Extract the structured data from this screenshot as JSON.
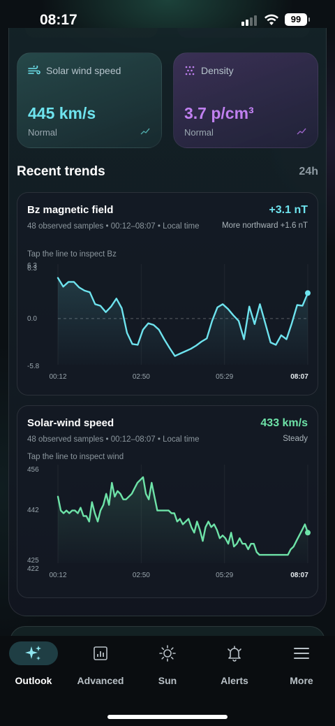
{
  "status_bar": {
    "time": "08:17",
    "battery": "99"
  },
  "metrics": {
    "wind": {
      "label": "Solar wind speed",
      "value": "445 km/s",
      "status": "Normal",
      "icon": "wind-icon",
      "color": "#6ee3ee"
    },
    "density": {
      "label": "Density",
      "value": "3.7 p/cm³",
      "status": "Normal",
      "icon": "particles-icon",
      "color": "#c080f0"
    }
  },
  "trends": {
    "title": "Recent trends",
    "range": "24h"
  },
  "bz_card": {
    "title": "Bz magnetic field",
    "subtitle": "48 observed samples • 00:12–08:07 • Local time",
    "value": "+3.1 nT",
    "note": "More northward +1.6 nT",
    "hint": "Tap the line to inspect Bz",
    "value_color": "#6ee3ee"
  },
  "wind_card": {
    "title": "Solar-wind speed",
    "subtitle": "48 observed samples • 00:12–08:07 • Local time",
    "value": "433 km/s",
    "note": "Steady",
    "hint": "Tap the line to inspect wind",
    "value_color": "#6ee3a8"
  },
  "chart_data": [
    {
      "type": "line",
      "title": "Bz magnetic field",
      "x_ticks": [
        "00:12",
        "02:50",
        "05:29",
        "08:07"
      ],
      "y_ticks": [
        "6.3",
        "6.3",
        "0.0",
        "-5.8"
      ],
      "ylim": [
        -5.8,
        6.3
      ],
      "zero_line": true,
      "color": "#6ee3ee",
      "series": [
        {
          "values": [
            5.1,
            4.0,
            4.6,
            4.6,
            3.9,
            3.5,
            3.3,
            1.8,
            1.6,
            0.8,
            1.5,
            2.5,
            1.3,
            -1.8,
            -3.2,
            -3.3,
            -1.4,
            -0.6,
            -0.8,
            -1.4,
            -2.6,
            -3.7,
            -4.7,
            -4.4,
            -4.1,
            -3.8,
            -3.4,
            -2.9,
            -2.5,
            -0.3,
            1.4,
            1.8,
            1.2,
            0.4,
            -0.3,
            -2.6,
            1.5,
            -0.7,
            1.8,
            -0.6,
            -3.0,
            -3.3,
            -2.1,
            -2.6,
            -0.6,
            1.7,
            1.6,
            3.2
          ]
        }
      ]
    },
    {
      "type": "line",
      "title": "Solar-wind speed",
      "x_ticks": [
        "00:12",
        "02:50",
        "05:29",
        "08:07"
      ],
      "y_ticks": [
        "456",
        "442",
        "425",
        "422"
      ],
      "ylim": [
        422,
        456
      ],
      "color": "#6ee3a8",
      "series": [
        {
          "values": [
            446,
            441,
            440,
            441,
            440,
            441,
            441,
            440,
            442,
            439,
            439,
            437,
            444,
            440,
            437,
            441,
            443,
            447,
            443,
            451,
            446,
            448,
            447,
            445,
            445,
            446,
            447,
            449,
            451,
            452,
            453,
            447,
            445,
            451,
            446,
            441,
            441,
            441,
            441,
            441,
            440,
            440,
            437,
            438,
            436,
            437,
            438,
            435,
            433,
            437,
            434,
            430,
            435,
            437,
            435,
            436,
            434,
            431,
            432,
            431,
            429,
            433,
            428,
            429,
            431,
            429,
            429,
            427,
            429,
            429,
            426,
            425,
            425,
            425,
            425,
            425,
            425,
            425,
            425,
            425,
            425,
            425,
            427,
            428,
            430,
            432,
            434,
            436,
            433
          ]
        }
      ]
    }
  ],
  "tabs": [
    {
      "label": "Outlook",
      "icon": "sparkle-icon",
      "active": true
    },
    {
      "label": "Advanced",
      "icon": "chart-icon",
      "active": false
    },
    {
      "label": "Sun",
      "icon": "sun-icon",
      "active": false
    },
    {
      "label": "Alerts",
      "icon": "bell-icon",
      "active": false
    },
    {
      "label": "More",
      "icon": "menu-icon",
      "active": false
    }
  ]
}
